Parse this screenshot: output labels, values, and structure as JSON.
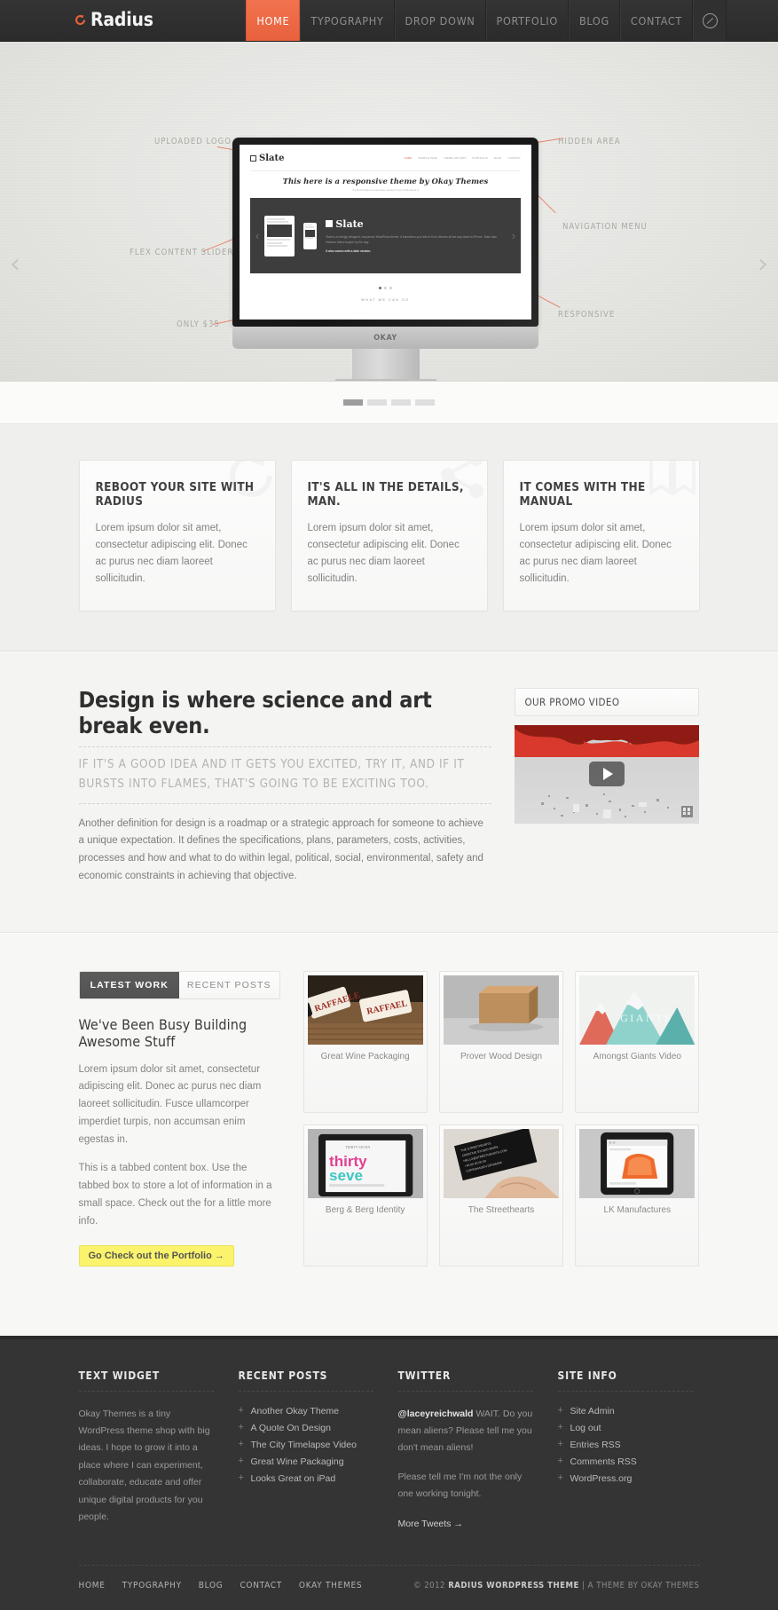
{
  "header": {
    "logo_text": "Radius",
    "logo_icon": "circular-arrow-icon",
    "nav": [
      {
        "label": "HOME",
        "active": true
      },
      {
        "label": "TYPOGRAPHY",
        "active": false
      },
      {
        "label": "DROP DOWN",
        "active": false
      },
      {
        "label": "PORTFOLIO",
        "active": false
      },
      {
        "label": "BLOG",
        "active": false
      },
      {
        "label": "CONTACT",
        "active": false
      }
    ],
    "search_icon": "search-icon"
  },
  "hero": {
    "prev_arrow": "‹",
    "next_arrow": "›",
    "callouts": [
      {
        "label": "UPLOADED LOGO"
      },
      {
        "label": "HIDDEN AREA"
      },
      {
        "label": "NAVIGATION MENU"
      },
      {
        "label": "FLEX CONTENT SLIDER"
      },
      {
        "label": "RESPONSIVE"
      },
      {
        "label": "ONLY $35"
      }
    ],
    "monitor_brand": "OKAY",
    "screen": {
      "logo": "Slate",
      "nav": [
        "HOME",
        "SAMPLE PAGE",
        "THEME OPTIONS",
        "PORTFOLIO",
        "BLOG",
        "CONTACT"
      ],
      "headline": "This here is a responsive theme by Okay Themes",
      "subline": "It's kind of like a responsive moment if you think about it",
      "slide_logo": "Slate",
      "slide_body": "Slate is a lovingly designed, responsive WordPress theme. It transforms your site to fit on devices all the way down to iPhone. Team also features retina support by the way.",
      "slide_bold": "It also comes with a dark version.",
      "section_label": "WHAT WE CAN DO"
    },
    "pager": [
      {
        "active": true
      },
      {
        "active": false
      },
      {
        "active": false
      },
      {
        "active": false
      }
    ]
  },
  "features": [
    {
      "title": "REBOOT YOUR SITE WITH RADIUS",
      "body": "Lorem ipsum dolor sit amet, consectetur adipiscing elit. Donec ac purus nec diam laoreet sollicitudin.",
      "icon": "refresh-arrow-icon"
    },
    {
      "title": "IT'S ALL IN THE DETAILS, MAN.",
      "body": "Lorem ipsum dolor sit amet, consectetur adipiscing elit. Donec ac purus nec diam laoreet sollicitudin.",
      "icon": "share-node-icon"
    },
    {
      "title": "IT COMES WITH THE MANUAL",
      "body": "Lorem ipsum dolor sit amet, consectetur adipiscing elit. Donec ac purus nec diam laoreet sollicitudin.",
      "icon": "book-icon"
    }
  ],
  "design": {
    "heading": "Design is where science and art break even.",
    "subheading": "IF IT'S A GOOD IDEA AND IT GETS YOU EXCITED, TRY IT, AND IF IT BURSTS INTO FLAMES, THAT'S GOING TO BE EXCITING TOO.",
    "body": "Another definition for design is a roadmap or a strategic approach for someone to achieve a unique expectation. It defines the specifications, plans, parameters, costs, activities, processes and how and what to do within legal, political, social, environmental, safety and economic constraints in achieving that objective.",
    "promo_title": "OUR PROMO VIDEO",
    "play_icon": "play-icon",
    "fullscreen_icon": "fullscreen-icon"
  },
  "work": {
    "tabs": [
      {
        "label": "LATEST WORK",
        "active": true
      },
      {
        "label": "RECENT POSTS",
        "active": false
      }
    ],
    "title": "We've Been Busy Building Awesome Stuff",
    "para1": "Lorem ipsum dolor sit amet, consectetur adipiscing elit. Donec ac purus nec diam laoreet sollicitudin. Fusce ullamcorper imperdiet turpis, non accumsan enim egestas in.",
    "para2": "This is a tabbed content box. Use the tabbed box to store a lot of information in a small space. Check out the for a little more info.",
    "cta_label": "Go Check out the Portfolio →",
    "cta_color": "#faf36b",
    "items": [
      {
        "caption": "Great Wine Packaging",
        "thumb": "wine-bottles"
      },
      {
        "caption": "Prover Wood Design",
        "thumb": "cardboard-box"
      },
      {
        "caption": "Amongst Giants Video",
        "thumb": "giants-mountains"
      },
      {
        "caption": "Berg & Berg Identity",
        "thumb": "thirty-seven-tablet"
      },
      {
        "caption": "The Streethearts",
        "thumb": "black-business-cards"
      },
      {
        "caption": "LK Manufactures",
        "thumb": "ipad-orange"
      }
    ]
  },
  "footer": {
    "columns": [
      {
        "title": "TEXT WIDGET",
        "type": "text",
        "body": "Okay Themes is a tiny WordPress theme shop with big ideas. I hope to grow it into a place where I can experiment, collaborate, educate and offer unique digital products for you people."
      },
      {
        "title": "RECENT POSTS",
        "type": "list",
        "items": [
          "Another Okay Theme",
          "A Quote On Design",
          "The City Timelapse Video",
          "Great Wine Packaging",
          "Looks Great on iPad"
        ]
      },
      {
        "title": "TWITTER",
        "type": "twitter",
        "handle": "@laceyreichwald",
        "tweet1": " WAIT. Do you mean aliens? Please tell me you don't mean aliens!",
        "tweet2": "Please tell me I'm not the only one working tonight.",
        "more_label": "More Tweets →"
      },
      {
        "title": "SITE INFO",
        "type": "list",
        "items": [
          "Site Admin",
          "Log out",
          "Entries RSS",
          "Comments RSS",
          "WordPress.org"
        ]
      }
    ],
    "bottom_nav": [
      "HOME",
      "TYPOGRAPHY",
      "BLOG",
      "CONTACT",
      "OKAY THEMES"
    ],
    "copyright_prefix": "© 2012 ",
    "copyright_brand": "RADIUS WORDPRESS THEME",
    "copyright_suffix": " | A THEME BY OKAY THEMES"
  },
  "colors": {
    "accent": "#e8603c",
    "header_bg": "#2f2f2f",
    "footer_bg": "#343434",
    "cta": "#faf36b"
  }
}
